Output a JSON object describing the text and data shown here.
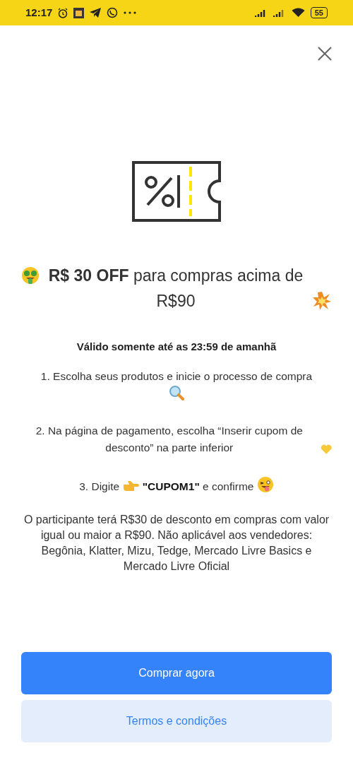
{
  "status_bar": {
    "time": "12:17",
    "battery": "55"
  },
  "offer": {
    "title": "**R$ 30 OFF** para compras acima de R$90",
    "validity": "Válido somente até as 23:59 de amanhã"
  },
  "steps": [
    {
      "text": "1. Escolha seus produtos e inicie o processo de compra"
    },
    {
      "text": "2. Na página de pagamento, escolha “Inserir cupom de desconto” na parte inferior"
    },
    {
      "text": "3. Digite",
      "code": "\"CUPOM1\"",
      "after": "e confirme"
    }
  ],
  "terms_text": "O participante terá R$30 de desconto em compras com valor igual ou maior a R$90. Não aplicável aos vendedores: Begônia, Klatter, Mizu, Tedge, Mercado Livre Basics e Mercado Livre Oficial",
  "buttons": [
    {
      "label": "Comprar agora",
      "kind": "primary"
    },
    {
      "label": "Termos e condições",
      "kind": "secondary"
    }
  ]
}
